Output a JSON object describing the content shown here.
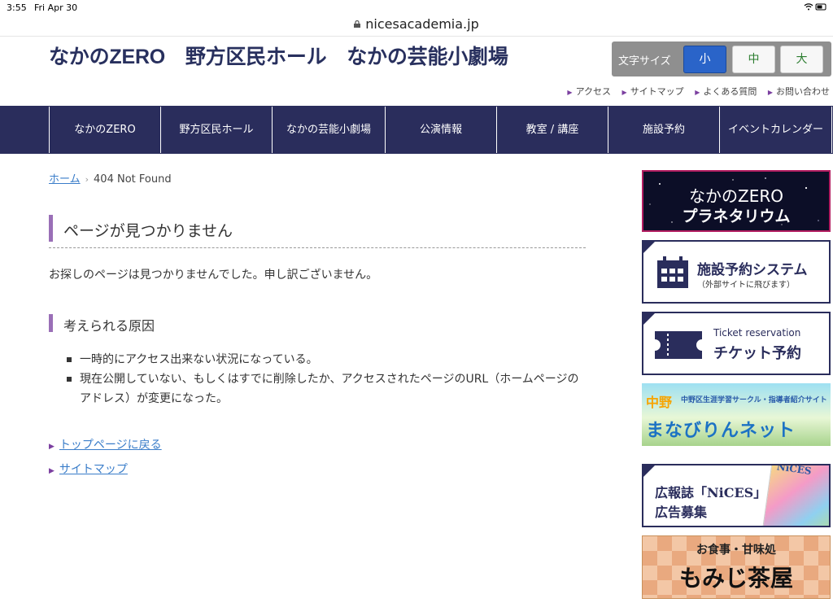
{
  "status_bar": {
    "time": "3:55",
    "date": "Fri Apr 30",
    "url": "nicesacademia.jp"
  },
  "header": {
    "title": "なかのZERO　野方区民ホール　なかの芸能小劇場"
  },
  "font_size": {
    "label": "文字サイズ",
    "options": [
      "小",
      "中",
      "大"
    ],
    "selected": "小",
    "active_color": "#2a64c9"
  },
  "util_links": [
    "アクセス",
    "サイトマップ",
    "よくある質問",
    "お問い合わせ"
  ],
  "nav": [
    "なかのZERO",
    "野方区民ホール",
    "なかの芸能小劇場",
    "公演情報",
    "教室 / 講座",
    "施設予約",
    "イベントカレンダー"
  ],
  "breadcrumb": {
    "home": "ホーム",
    "current": "404 Not Found"
  },
  "main": {
    "heading": "ページが見つかりません",
    "message": "お探しのページは見つかりませんでした。申し訳ございません。",
    "subheading": "考えられる原因",
    "reasons": [
      "一時的にアクセス出来ない状況になっている。",
      "現在公開していない、もしくはすでに削除したか、アクセスされたページのURL（ホームページのアドレス）が変更になった。"
    ],
    "links": [
      "トップページに戻る",
      "サイトマップ"
    ]
  },
  "sidebar": {
    "planetarium": {
      "line1": "なかのZERO",
      "line2": "プラネタリウム"
    },
    "facility": {
      "title": "施設予約システム",
      "sub": "（外部サイトに飛びます）"
    },
    "ticket": {
      "en": "Ticket reservation",
      "ja": "チケット予約"
    },
    "manabi": {
      "badge": "中野",
      "sub": "中野区生涯学習サークル・指導者紹介サイト",
      "title": "まなびりんネット"
    },
    "nices": {
      "line1": "広報誌「NiCES」",
      "line2": "広告募集",
      "mag_title": "NiCES"
    },
    "momiji": {
      "line1": "お食事・甘味処",
      "line2": "もみじ茶屋"
    }
  },
  "colors": {
    "nav_bg": "#2a2d5c",
    "accent_purple": "#9a6fb7",
    "link": "#3a7dc9"
  }
}
